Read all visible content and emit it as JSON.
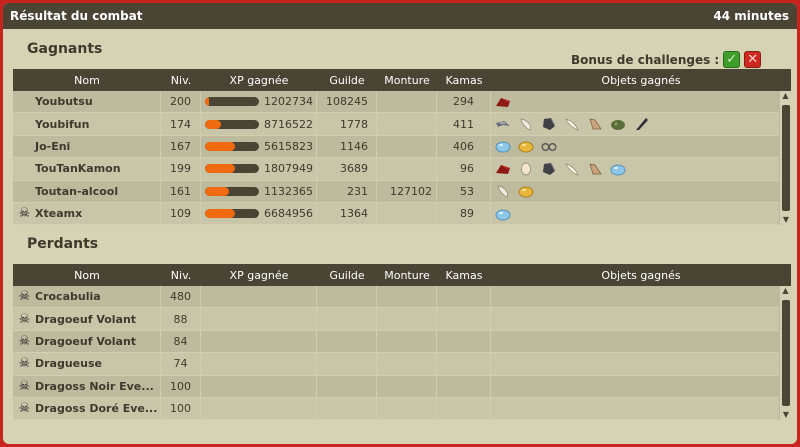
{
  "title": "Résultat du combat",
  "duration": "44 minutes",
  "bonus_label": "Bonus de challenges :",
  "winners_label": "Gagnants",
  "losers_label": "Perdants",
  "columns": [
    "Nom",
    "Niv.",
    "XP gagnée",
    "Guilde",
    "Monture",
    "Kamas",
    "Objets gagnés"
  ],
  "winners": [
    {
      "name": "Youbutsu",
      "level": "200",
      "xp": "1202734",
      "xp_fill": 0.08,
      "guild": "108245",
      "mount": "",
      "kamas": "294",
      "dead": false,
      "items": [
        "red-cloak-item"
      ]
    },
    {
      "name": "Youbifun",
      "level": "174",
      "xp": "8716522",
      "xp_fill": 0.3,
      "guild": "1778",
      "mount": "",
      "kamas": "411",
      "dead": false,
      "items": [
        "wing-item",
        "feather-item",
        "dark-cloth-item",
        "tusk-item",
        "horn-item",
        "green-shell-item",
        "dark-blade-item"
      ]
    },
    {
      "name": "Jo-Eni",
      "level": "167",
      "xp": "5615823",
      "xp_fill": 0.55,
      "guild": "1146",
      "mount": "",
      "kamas": "406",
      "dead": false,
      "items": [
        "blue-egg-item",
        "gold-egg-item",
        "glasses-item"
      ]
    },
    {
      "name": "TouTanKamon",
      "level": "199",
      "xp": "1807949",
      "xp_fill": 0.55,
      "guild": "3689",
      "mount": "",
      "kamas": "96",
      "dead": false,
      "items": [
        "red-cloak-item",
        "egg-item",
        "dark-cloth-item",
        "tusk-item",
        "horn-item",
        "blue-egg-item"
      ]
    },
    {
      "name": "Toutan-alcool",
      "level": "161",
      "xp": "1132365",
      "xp_fill": 0.45,
      "guild": "231",
      "mount": "127102",
      "kamas": "53",
      "dead": false,
      "items": [
        "feather-item",
        "gold-egg-item"
      ]
    },
    {
      "name": "Xteamx",
      "level": "109",
      "xp": "6684956",
      "xp_fill": 0.55,
      "guild": "1364",
      "mount": "",
      "kamas": "89",
      "dead": true,
      "items": [
        "blue-egg-item"
      ]
    }
  ],
  "losers": [
    {
      "name": "Crocabulia",
      "level": "480"
    },
    {
      "name": "Dragoeuf Volant",
      "level": "88"
    },
    {
      "name": "Dragoeuf Volant",
      "level": "84"
    },
    {
      "name": "Dragueuse",
      "level": "74"
    },
    {
      "name": "Dragoss Noir Eve...",
      "level": "100"
    },
    {
      "name": "Dragoss Doré Eve...",
      "level": "100"
    }
  ],
  "colors": {
    "header": "#4a4434",
    "xp_bar": "#f06a10",
    "frame": "#c8241e",
    "challenge_ok": "#3f9e2a",
    "challenge_fail": "#cc2a20"
  }
}
